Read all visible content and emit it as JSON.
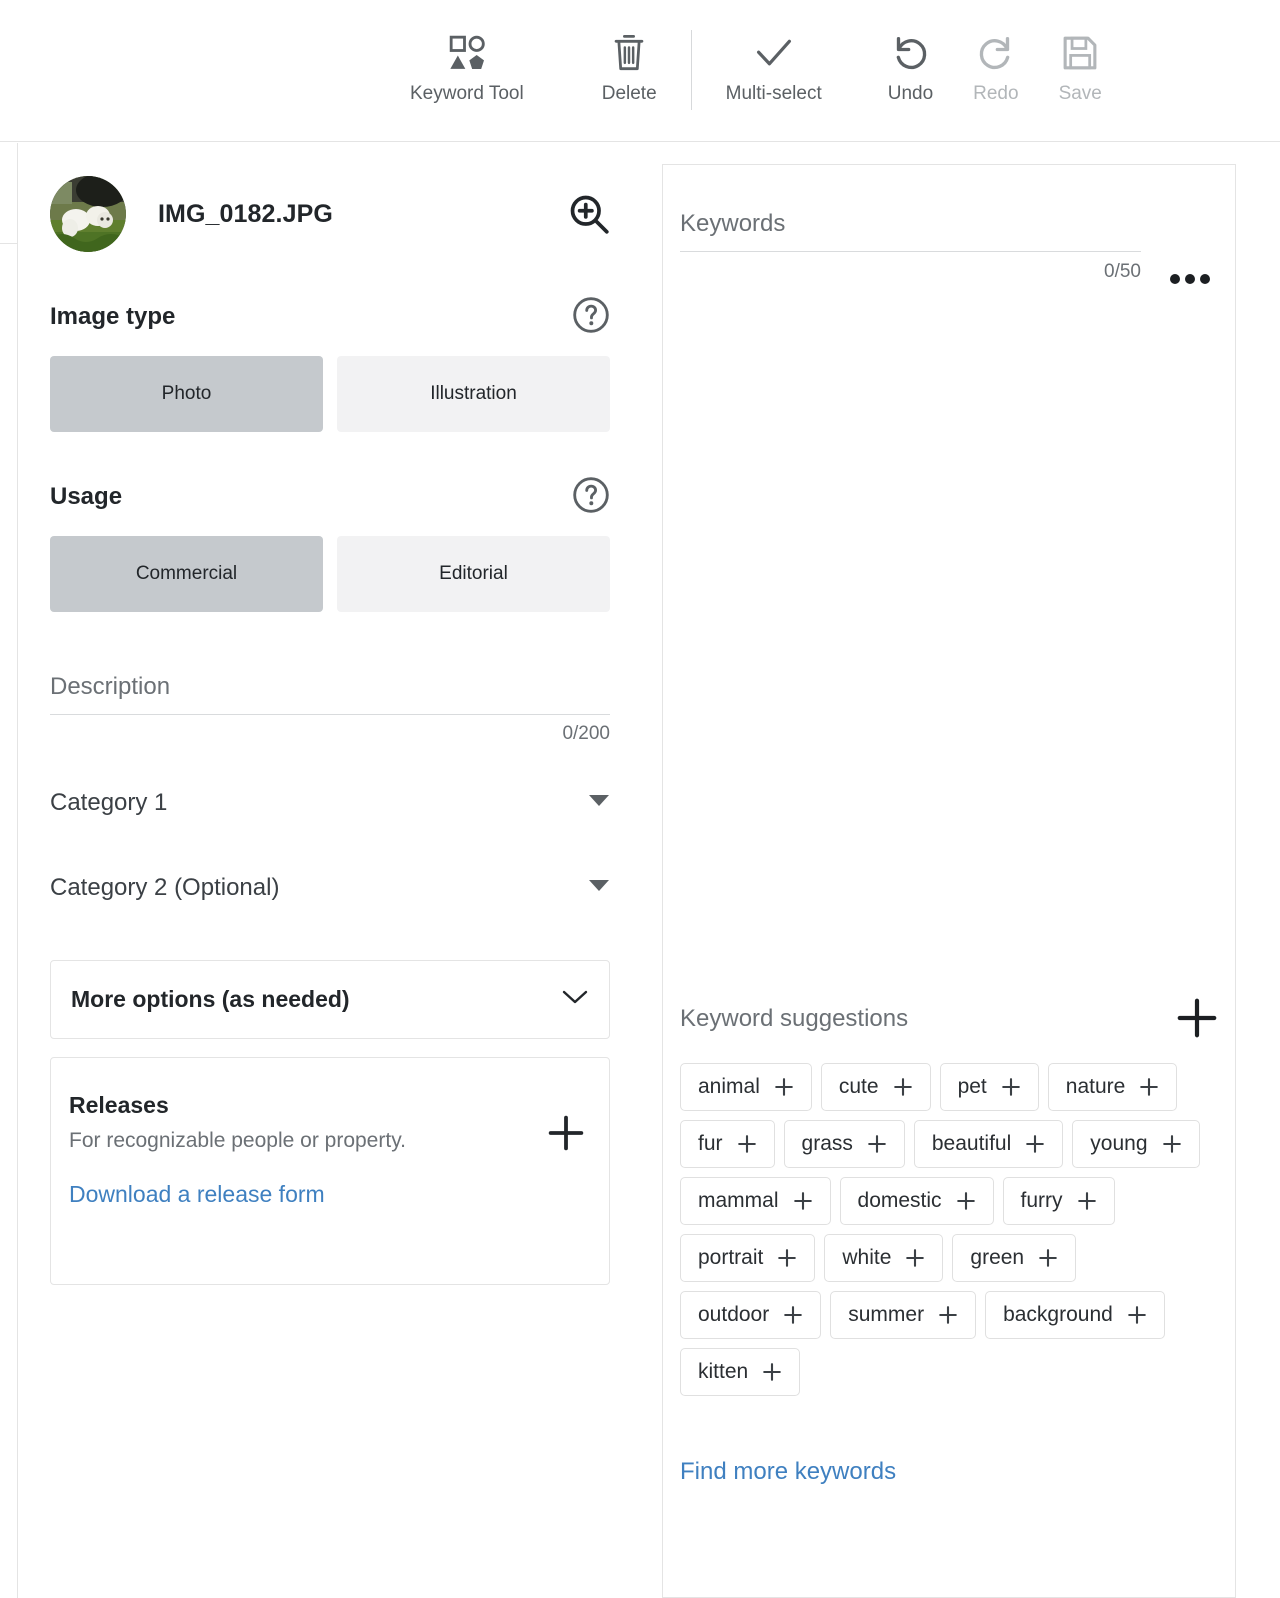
{
  "toolbar": {
    "items": [
      {
        "label": "Keyword Tool",
        "icon": "shapes-grid-icon",
        "disabled": false
      },
      {
        "label": "Delete",
        "icon": "trash-icon",
        "disabled": false
      },
      {
        "label": "Multi-select",
        "icon": "check-icon",
        "disabled": false
      },
      {
        "label": "Undo",
        "icon": "undo-arrow-icon",
        "disabled": false
      },
      {
        "label": "Redo",
        "icon": "redo-arrow-icon",
        "disabled": true
      },
      {
        "label": "Save",
        "icon": "floppy-disk-icon",
        "disabled": true
      }
    ]
  },
  "left_panel": {
    "file_name": "IMG_0182.JPG",
    "zoom_icon": "magnifier-plus-icon",
    "image_type": {
      "title": "Image type",
      "help_icon": "question-circle-icon",
      "options": [
        "Photo",
        "Illustration"
      ],
      "selected": "Photo"
    },
    "usage": {
      "title": "Usage",
      "help_icon": "question-circle-icon",
      "options": [
        "Commercial",
        "Editorial"
      ],
      "selected": "Commercial"
    },
    "description": {
      "label": "Description",
      "value": "",
      "counter": "0/200"
    },
    "category1": {
      "label": "Category 1",
      "value": "",
      "caret_icon": "caret-down-icon"
    },
    "category2": {
      "label": "Category 2 (Optional)",
      "value": "",
      "caret_icon": "caret-down-icon"
    },
    "more_options": {
      "label": "More options (as needed)",
      "chevron_icon": "chevron-down-icon"
    },
    "releases": {
      "title": "Releases",
      "subtitle": "For recognizable people or property.",
      "link": "Download a release form",
      "add_icon": "plus-icon"
    }
  },
  "keywords_panel": {
    "label": "Keywords",
    "value": "",
    "counter": "0/50",
    "menu_icon": "ellipsis-icon"
  },
  "suggestions_panel": {
    "label": "Keyword suggestions",
    "add_all_icon": "plus-icon",
    "chips": [
      "animal",
      "cute",
      "pet",
      "nature",
      "fur",
      "grass",
      "beautiful",
      "young",
      "mammal",
      "domestic",
      "furry",
      "portrait",
      "white",
      "green",
      "outdoor",
      "summer",
      "background",
      "kitten"
    ],
    "chip_add_icon": "plus-icon",
    "find_more": "Find more keywords"
  },
  "colors": {
    "accent_link": "#3f80c0",
    "segment_selected": "#c5c9cd",
    "segment_unselected": "#f2f2f3",
    "border": "#e4e4e4",
    "text_primary": "#22262a",
    "text_secondary": "#6b7075",
    "text_disabled": "#b2b6b9"
  }
}
